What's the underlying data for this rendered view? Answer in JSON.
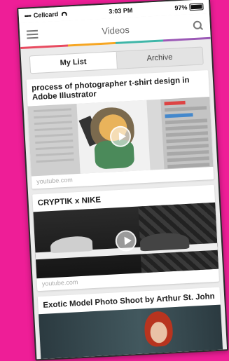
{
  "statusbar": {
    "carrier": "Cellcard",
    "signal_dots": "•••••",
    "time": "3:03 PM",
    "battery": "97%"
  },
  "navbar": {
    "title": "Videos",
    "menu_icon": "hamburger-menu-icon",
    "search_icon": "search-icon"
  },
  "tabs": [
    {
      "label": "My List",
      "active": true
    },
    {
      "label": "Archive",
      "active": false
    }
  ],
  "cards": [
    {
      "title": "process of photographer t-shirt design in Adobe Illustrator",
      "source": "youtube.com"
    },
    {
      "title": "CRYPTIK x NIKE",
      "source": "youtube.com"
    },
    {
      "title": "Exotic Model Photo Shoot by Arthur St. John",
      "source": ""
    }
  ],
  "colors": {
    "background": "#ee1e97",
    "tab_strip": [
      "#e84a5f",
      "#f6a623",
      "#3fb6a8",
      "#9b59b6"
    ]
  }
}
